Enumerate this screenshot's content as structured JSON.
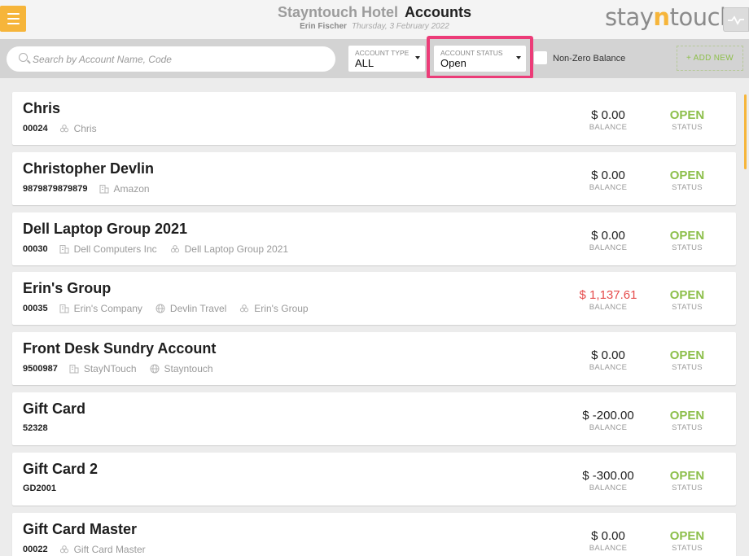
{
  "header": {
    "hotel_name": "Stayntouch Hotel",
    "page_title": "Accounts",
    "user": "Erin Fischer",
    "date": "Thursday, 3 February 2022",
    "logo_prefix": "stay",
    "logo_n": "n",
    "logo_suffix": "touch"
  },
  "filters": {
    "search_placeholder": "Search by Account Name, Code",
    "account_type_label": "ACCOUNT TYPE",
    "account_type_value": "ALL",
    "account_status_label": "ACCOUNT STATUS",
    "account_status_value": "Open",
    "nonzero_label": "Non-Zero Balance",
    "nonzero_checked": false,
    "add_new_label": "+ ADD NEW"
  },
  "colors": {
    "accent": "#f6b53a",
    "open_status": "#8dbf4b",
    "negative_balance": "#e54c4c",
    "highlight": "#ec3c78"
  },
  "accounts": [
    {
      "name": "Chris",
      "code": "00024",
      "tags": [
        {
          "icon": "group-icon",
          "text": "Chris"
        }
      ],
      "balance": "$ 0.00",
      "balance_label": "BALANCE",
      "status": "OPEN",
      "status_label": "STATUS"
    },
    {
      "name": "Christopher Devlin",
      "code": "9879879879879",
      "tags": [
        {
          "icon": "company-icon",
          "text": "Amazon"
        }
      ],
      "balance": "$ 0.00",
      "balance_label": "BALANCE",
      "status": "OPEN",
      "status_label": "STATUS"
    },
    {
      "name": "Dell Laptop Group 2021",
      "code": "00030",
      "tags": [
        {
          "icon": "company-icon",
          "text": "Dell Computers Inc"
        },
        {
          "icon": "group-icon",
          "text": "Dell Laptop Group 2021"
        }
      ],
      "balance": "$ 0.00",
      "balance_label": "BALANCE",
      "status": "OPEN",
      "status_label": "STATUS"
    },
    {
      "name": "Erin's Group",
      "code": "00035",
      "tags": [
        {
          "icon": "company-icon",
          "text": "Erin's Company"
        },
        {
          "icon": "globe-icon",
          "text": "Devlin Travel"
        },
        {
          "icon": "group-icon",
          "text": "Erin's Group"
        }
      ],
      "balance": "$ 1,137.61",
      "balance_negative": true,
      "balance_label": "BALANCE",
      "status": "OPEN",
      "status_label": "STATUS"
    },
    {
      "name": "Front Desk Sundry Account",
      "code": "9500987",
      "tags": [
        {
          "icon": "company-icon",
          "text": "StayNTouch"
        },
        {
          "icon": "globe-icon",
          "text": "Stayntouch"
        }
      ],
      "balance": "$ 0.00",
      "balance_label": "BALANCE",
      "status": "OPEN",
      "status_label": "STATUS"
    },
    {
      "name": "Gift Card",
      "code": "52328",
      "tags": [],
      "balance": "$ -200.00",
      "balance_label": "BALANCE",
      "status": "OPEN",
      "status_label": "STATUS"
    },
    {
      "name": "Gift Card 2",
      "code": "GD2001",
      "tags": [],
      "balance": "$ -300.00",
      "balance_label": "BALANCE",
      "status": "OPEN",
      "status_label": "STATUS"
    },
    {
      "name": "Gift Card Master",
      "code": "00022",
      "tags": [
        {
          "icon": "group-icon",
          "text": "Gift Card Master"
        }
      ],
      "balance": "$ 0.00",
      "balance_label": "BALANCE",
      "status": "OPEN",
      "status_label": "STATUS"
    }
  ]
}
